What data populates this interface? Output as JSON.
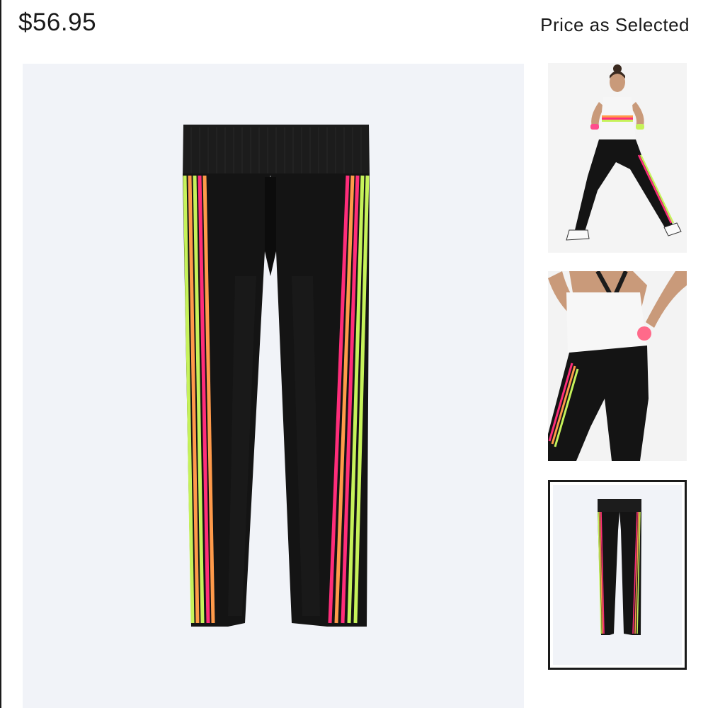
{
  "header": {
    "price": "$56.95",
    "price_note": "Price as Selected"
  },
  "gallery": {
    "main_image": "leggings-flat-lay",
    "thumbnails": [
      {
        "name": "model-front-pose",
        "selected": false
      },
      {
        "name": "model-back-view",
        "selected": false
      },
      {
        "name": "leggings-flat-lay",
        "selected": true
      }
    ]
  },
  "colors": {
    "background": "#f1f3f8",
    "leggings": "#141414",
    "stripe_pink": "#ff2d7a",
    "stripe_orange": "#ff9a4a",
    "stripe_green": "#c6f25a",
    "selected_border": "#1a1a1a"
  }
}
